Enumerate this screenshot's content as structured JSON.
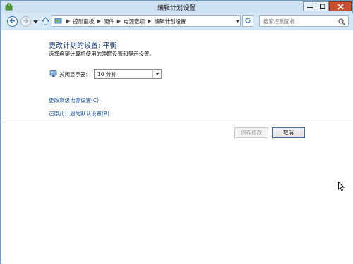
{
  "window": {
    "title": "编辑计划设置",
    "controls": [
      "minimize-icon",
      "maximize-icon",
      "close-icon"
    ]
  },
  "navbar": {
    "breadcrumbs": [
      "控制面板",
      "硬件",
      "电源选项",
      "编辑计划设置"
    ],
    "search_placeholder": "搜索控制面板"
  },
  "main": {
    "heading": "更改计划的设置: 平衡",
    "subtitle": "选择希望计算机使用的睡眠设置和显示设置。",
    "display_off": {
      "label": "关闭显示器:",
      "value": "10 分钟"
    },
    "links": {
      "advanced": "更改高级电源设置(C)",
      "restore": "还原此计划的默认设置(R)"
    },
    "buttons": {
      "save": "保存修改",
      "cancel": "取消"
    }
  },
  "colors": {
    "heading": "#1c3f86",
    "link": "#1e5aa8",
    "close_button": "#c7502f",
    "frame": "#cfe2f3"
  }
}
